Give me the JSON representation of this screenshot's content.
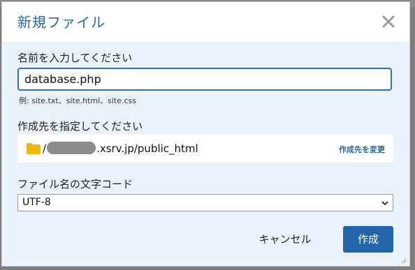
{
  "dialog": {
    "title": "新規ファイル",
    "close_icon": "close-icon"
  },
  "name_section": {
    "label": "名前を入力してください",
    "value": "database.php",
    "hint": "例: site.txt、site.html、site.css"
  },
  "destination_section": {
    "label": "作成先を指定してください",
    "folder_icon": "folder-icon",
    "path_prefix": "/",
    "path_suffix": ".xsrv.jp/public_html",
    "change_link": "作成先を変更"
  },
  "encoding_section": {
    "label": "ファイル名の文字コード",
    "selected": "UTF-8"
  },
  "actions": {
    "cancel": "キャンセル",
    "create": "作成"
  },
  "colors": {
    "accent": "#2468a8",
    "primary_button": "#2464a8",
    "body_bg": "#eaf2fb",
    "folder": "#f2b705"
  }
}
